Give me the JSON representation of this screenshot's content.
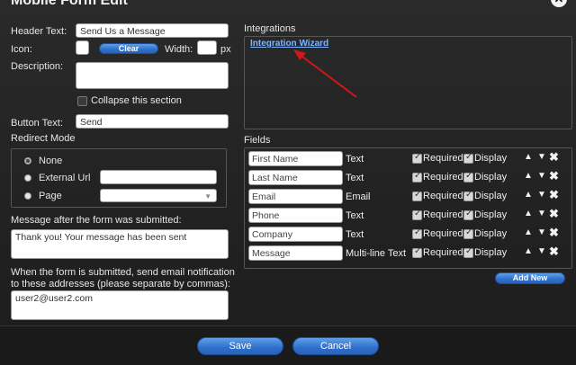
{
  "window": {
    "title": "Mobile Form Edit"
  },
  "left": {
    "header_text_label": "Header Text:",
    "header_text_value": "Send Us a Message",
    "icon_label": "Icon:",
    "clear_label": "Clear",
    "width_label": "Width:",
    "width_unit": "px",
    "description_label": "Description:",
    "description_value": "",
    "collapse_label": "Collapse this section",
    "button_text_label": "Button Text:",
    "button_text_value": "Send",
    "redirect_label": "Redirect Mode",
    "redirect_options": [
      "None",
      "External Url",
      "Page"
    ],
    "redirect_selected": "None",
    "message_label": "Message after the form was submitted:",
    "message_value": "Thank you! Your message has been sent",
    "email_label": "When the form is submitted, send email notification to these addresses (please separate by commas):",
    "email_value": "user2@user2.com"
  },
  "integrations": {
    "title": "Integrations",
    "wizard_link": "Integration Wizard"
  },
  "fields": {
    "title": "Fields",
    "required_label": "Required",
    "display_label": "Display",
    "add_new_label": "Add New",
    "rows": [
      {
        "name": "First Name",
        "type": "Text"
      },
      {
        "name": "Last Name",
        "type": "Text"
      },
      {
        "name": "Email",
        "type": "Email"
      },
      {
        "name": "Phone",
        "type": "Text"
      },
      {
        "name": "Company",
        "type": "Text"
      },
      {
        "name": "Message",
        "type": "Multi-line Text"
      }
    ]
  },
  "footer": {
    "save_label": "Save",
    "cancel_label": "Cancel"
  },
  "colors": {
    "accent": "#2f6fcc",
    "link": "#7fb4ff",
    "arrow": "#d01818"
  }
}
